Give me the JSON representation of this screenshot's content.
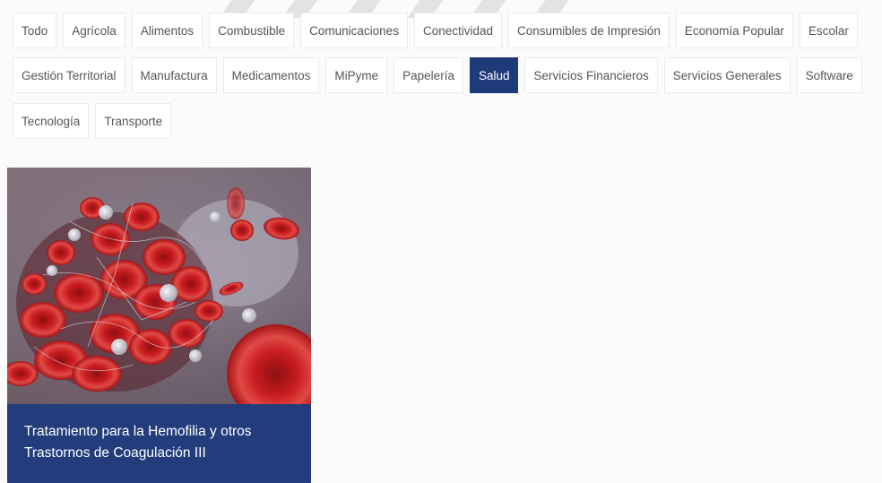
{
  "filters": {
    "row1": [
      "Todo",
      "Agrícola",
      "Alimentos",
      "Combustible",
      "Comunicaciones",
      "Conectividad",
      "Consumibles de Impresión",
      "Economía Popular",
      "Escolar"
    ],
    "row2": [
      "Gestión Territorial",
      "Manufactura",
      "Medicamentos",
      "MiPyme",
      "Papelería",
      "Salud",
      "Servicios Financieros",
      "Servicios Generales",
      "Software"
    ],
    "row3": [
      "Tecnología",
      "Transporte"
    ],
    "active": "Salud"
  },
  "card": {
    "title_line1": "Tratamiento para la Hemofilia y otros",
    "title_line2": "Trastornos de Coagulación III",
    "image": "blood-clot-illustration"
  },
  "colors": {
    "accent": "#1f3a78",
    "card_footer": "#233d7c",
    "page_background": "#fbfbfb"
  }
}
